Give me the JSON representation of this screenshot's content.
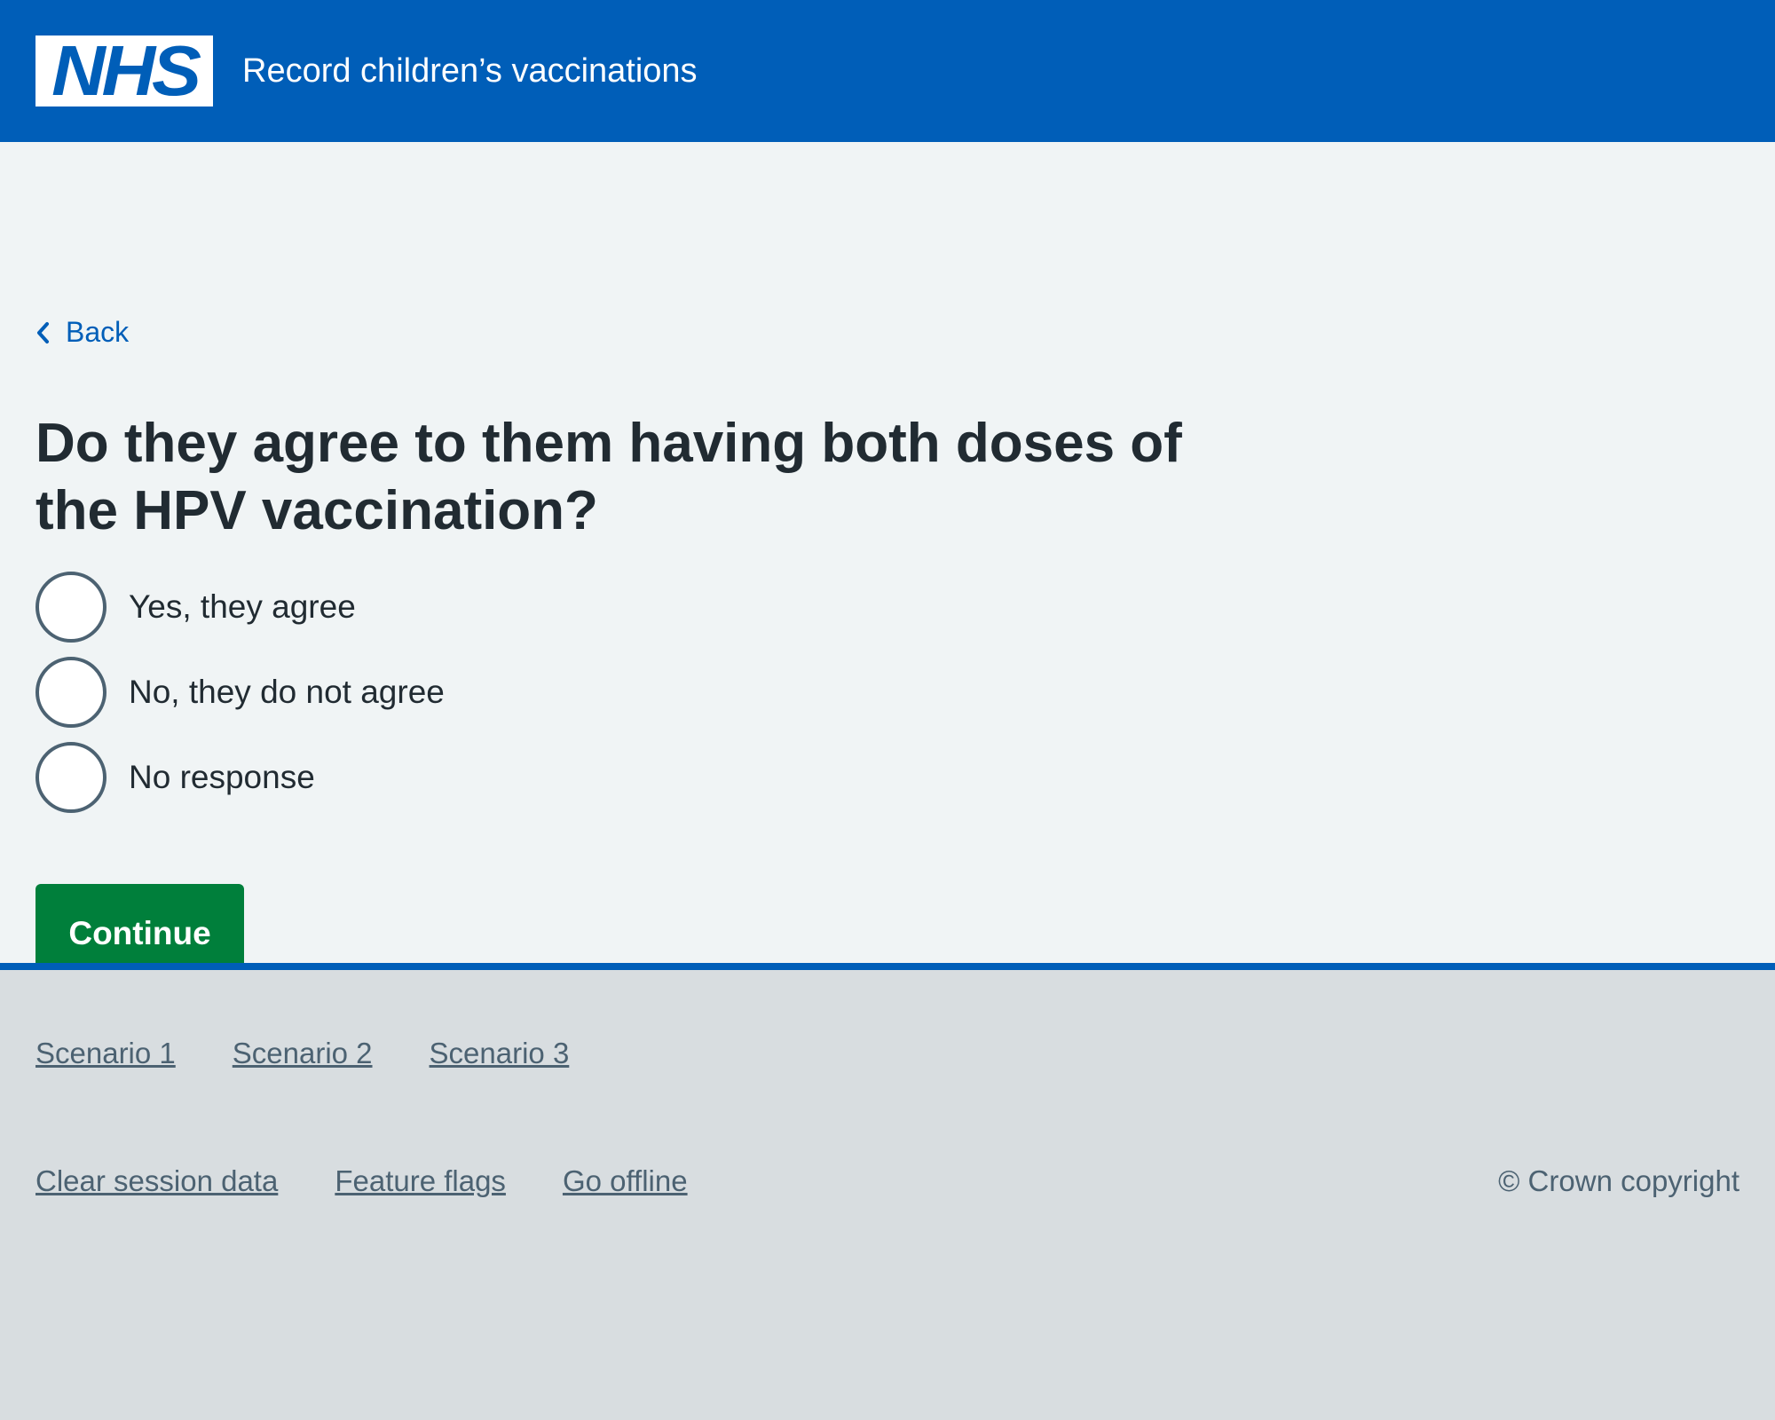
{
  "header": {
    "logo_text": "NHS",
    "service_name": "Record children’s vaccinations"
  },
  "main": {
    "back_label": "Back",
    "question": "Do they agree to them having both doses of the HPV vaccination?",
    "options": [
      {
        "label": "Yes, they agree",
        "selected": false
      },
      {
        "label": "No, they do not agree",
        "selected": false
      },
      {
        "label": "No response",
        "selected": false
      }
    ],
    "continue_label": "Continue"
  },
  "footer": {
    "scenarios": [
      "Scenario 1",
      "Scenario 2",
      "Scenario 3"
    ],
    "utility_links": [
      "Clear session data",
      "Feature flags",
      "Go offline"
    ],
    "copyright": "© Crown copyright"
  },
  "colors": {
    "header_bg": "#005eb8",
    "page_bg": "#f0f4f5",
    "footer_bg": "#d8dde0",
    "button_green": "#007f3b",
    "link_blue": "#005eb8",
    "text": "#212b32",
    "secondary_text": "#4c6272"
  }
}
